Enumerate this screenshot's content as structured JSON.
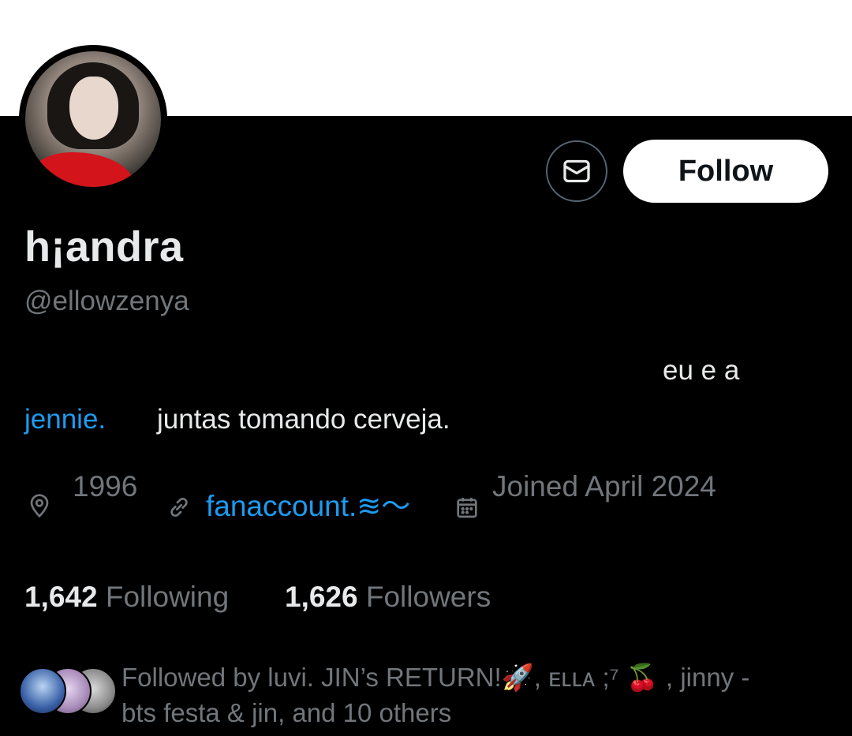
{
  "profile": {
    "display_name": "h¡andra",
    "handle": "@ellowzenya",
    "bio_line1": "eu e a",
    "bio_mention": "jennie.",
    "bio_line2": "juntas tomando cerveja.",
    "location": "1996",
    "website": "fanaccount.≋〜",
    "joined": "Joined April 2024"
  },
  "actions": {
    "message_icon": "envelope-icon",
    "follow_label": "Follow"
  },
  "stats": {
    "following_count": "1,642",
    "following_label": "Following",
    "followers_count": "1,626",
    "followers_label": "Followers"
  },
  "followed_by": {
    "line1": "Followed by luvi. JIN’s RETURN!🚀, ᴇʟʟᴀ ;⁷ 🍒 , jinny -",
    "line2": "bts festa & jin, and 10 others"
  },
  "colors": {
    "background": "#000000",
    "banner": "#ffffff",
    "primary_text": "#e7e9ea",
    "secondary_text": "#71767b",
    "link": "#1d9bf0",
    "button_border": "#536471"
  }
}
